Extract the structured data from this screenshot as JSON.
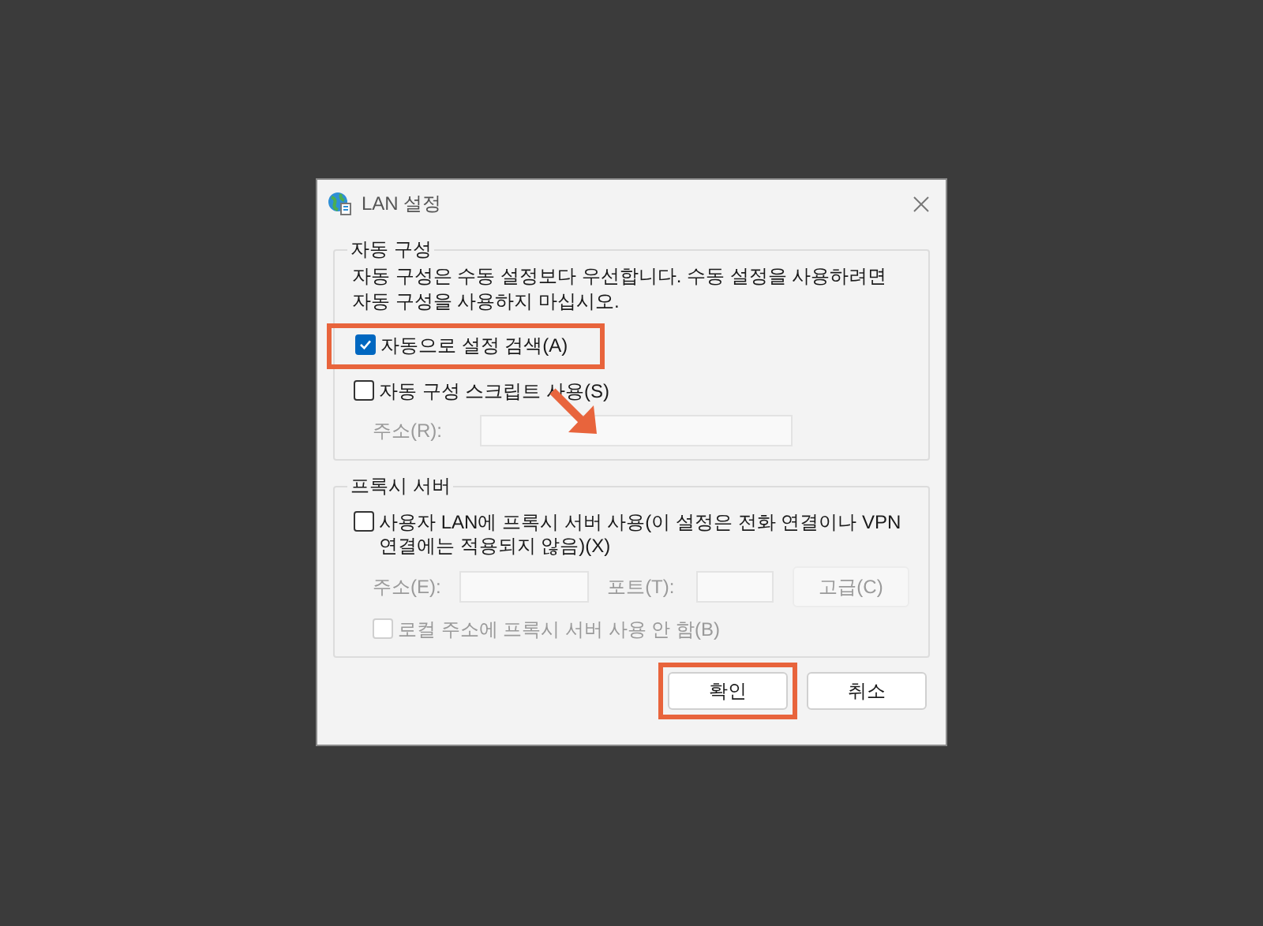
{
  "dialog": {
    "title": "LAN 설정",
    "groups": [
      {
        "title": "자동 구성",
        "description": "자동 구성은 수동 설정보다 우선합니다. 수동 설정을 사용하려면 자동 구성을 사용하지 마십시오.",
        "options": [
          {
            "kind": "checkbox",
            "label": "자동으로 설정 검색(A)",
            "checked": true,
            "disabled": false,
            "highlighted": true
          },
          {
            "kind": "checkbox",
            "label": "자동 구성 스크립트 사용(S)",
            "checked": false,
            "disabled": false,
            "highlighted": false
          },
          {
            "kind": "field",
            "label": "주소(R):",
            "disabled": true
          }
        ]
      },
      {
        "title": "프록시 서버",
        "options": [
          {
            "kind": "checkbox",
            "label": "사용자 LAN에 프록시 서버 사용(이 설정은 전화 연결이나 VPN 연결에는 적용되지 않음)(X)",
            "checked": false,
            "disabled": false,
            "highlighted": false
          },
          {
            "kind": "address_row",
            "address_label": "주소(E):",
            "port_label": "포트(T):",
            "button": "고급(C)",
            "disabled": true
          },
          {
            "kind": "checkbox",
            "label": "로컬 주소에 프록시 서버 사용 안 함(B)",
            "checked": false,
            "disabled": true,
            "highlighted": false
          }
        ]
      }
    ],
    "buttons": [
      {
        "label": "확인",
        "highlighted": true
      },
      {
        "label": "취소",
        "highlighted": false
      }
    ],
    "annotations": [
      {
        "kind": "arrow"
      }
    ]
  }
}
